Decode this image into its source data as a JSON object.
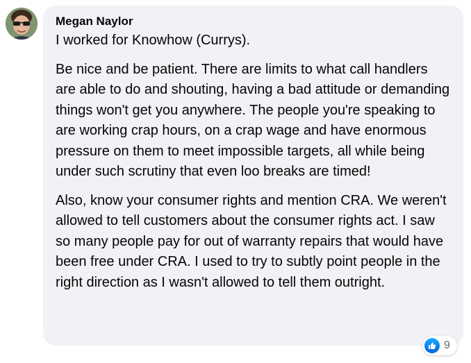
{
  "comment": {
    "author": "Megan Naylor",
    "paragraphs": [
      "I worked for Knowhow (Currys).",
      "Be nice and be patient. There are limits to what call handlers are able to do and shouting, having a bad attitude or demanding things won't get you anywhere. The people you're speaking to are working crap hours, on a crap wage and have enormous pressure on them to meet impossible targets, all while being under such scrutiny that even loo breaks are timed!",
      "Also, know your consumer rights and mention CRA. We weren't allowed to tell customers about the consumer rights act. I saw so many people pay for out of warranty repairs that would have been free under CRA. I used to try to subtly point people in the right direction as I wasn't allowed to tell them outright."
    ],
    "avatar_icon": "profile-photo",
    "reactions": {
      "icon": "like-icon",
      "count": "9",
      "color": "#1877f2"
    }
  }
}
